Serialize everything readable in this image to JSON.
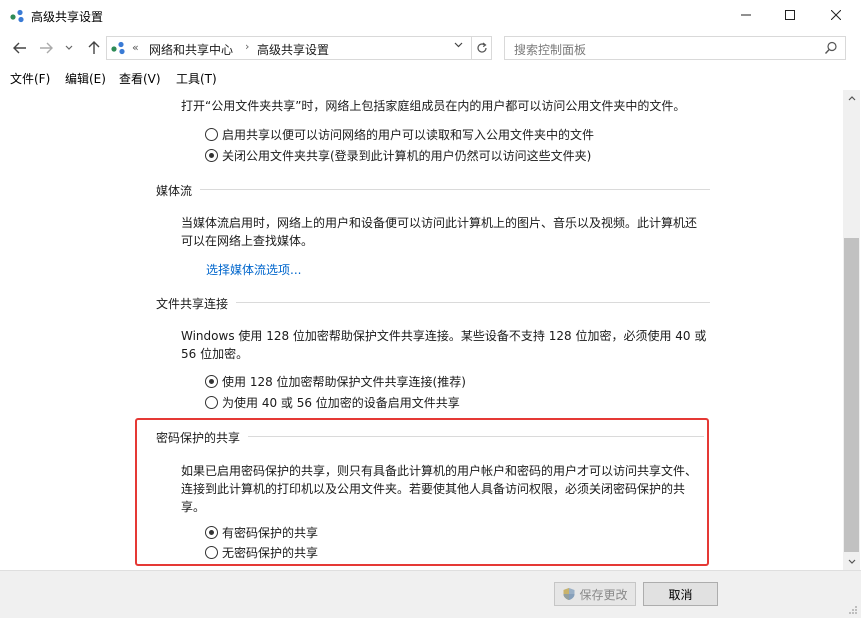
{
  "window": {
    "title": "高级共享设置"
  },
  "nav": {
    "back_icon": "back-arrow-icon",
    "forward_icon": "forward-arrow-icon",
    "up_icon": "up-arrow-icon",
    "breadcrumb_overflow": "«",
    "breadcrumbs": [
      "网络和共享中心",
      "高级共享设置"
    ],
    "breadcrumb_separator": "›",
    "search_placeholder": "搜索控制面板"
  },
  "menu": [
    "文件(F)",
    "编辑(E)",
    "查看(V)",
    "工具(T)"
  ],
  "public_folder": {
    "description": "打开“公用文件夹共享”时，网络上包括家庭组成员在内的用户都可以访问公用文件夹中的文件。",
    "options": [
      {
        "label": "启用共享以便可以访问网络的用户可以读取和写入公用文件夹中的文件",
        "selected": false
      },
      {
        "label": "关闭公用文件夹共享(登录到此计算机的用户仍然可以访问这些文件夹)",
        "selected": true
      }
    ]
  },
  "media_streaming": {
    "heading": "媒体流",
    "description_lines": [
      "当媒体流启用时，网络上的用户和设备便可以访问此计算机上的图片、音乐以及视频。此计算机还",
      "可以在网络上查找媒体。"
    ],
    "link": "选择媒体流选项..."
  },
  "file_sharing": {
    "heading": "文件共享连接",
    "description_lines": [
      "Windows 使用 128 位加密帮助保护文件共享连接。某些设备不支持 128 位加密，必须使用 40 或",
      "56 位加密。"
    ],
    "options": [
      {
        "label": "使用 128 位加密帮助保护文件共享连接(推荐)",
        "selected": true
      },
      {
        "label": "为使用 40 或 56 位加密的设备启用文件共享",
        "selected": false
      }
    ]
  },
  "password_sharing": {
    "heading": "密码保护的共享",
    "description_lines": [
      "如果已启用密码保护的共享，则只有具备此计算机的用户帐户和密码的用户才可以访问共享文件、",
      "连接到此计算机的打印机以及公用文件夹。若要使其他人具备访问权限，必须关闭密码保护的共",
      "享。"
    ],
    "options": [
      {
        "label": "有密码保护的共享",
        "selected": true
      },
      {
        "label": "无密码保护的共享",
        "selected": false
      }
    ],
    "highlight_color": "#e53935"
  },
  "footer": {
    "save_label": "保存更改",
    "save_icon": "uac-shield-icon",
    "cancel_label": "取消"
  }
}
